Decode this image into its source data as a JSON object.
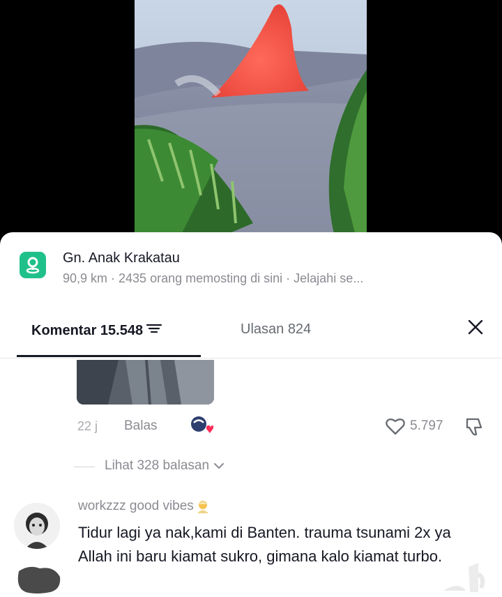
{
  "location": {
    "name": "Gn. Anak Krakatau",
    "meta": "90,9 km · 2435 orang memosting di sini · Jelajahi se...",
    "icon": "location-pin-icon",
    "icon_color": "#20c08a"
  },
  "tabs": {
    "comments_label": "Komentar 15.548",
    "reviews_label": "Ulasan 824"
  },
  "comment1": {
    "time": "22 j",
    "reply_label": "Balas",
    "likes": "5.797"
  },
  "replies": {
    "label": "Lihat 328 balasan"
  },
  "comment2": {
    "username": "workzzz good vibes",
    "text": "Tidur lagi ya nak,kami di Banten. trauma tsunami 2x ya Allah ini baru kiamat sukro, gimana kalo kiamat turbo."
  },
  "colors": {
    "text_primary": "#161823",
    "text_secondary": "#8a8b91",
    "lava": "#ff5a4a"
  }
}
